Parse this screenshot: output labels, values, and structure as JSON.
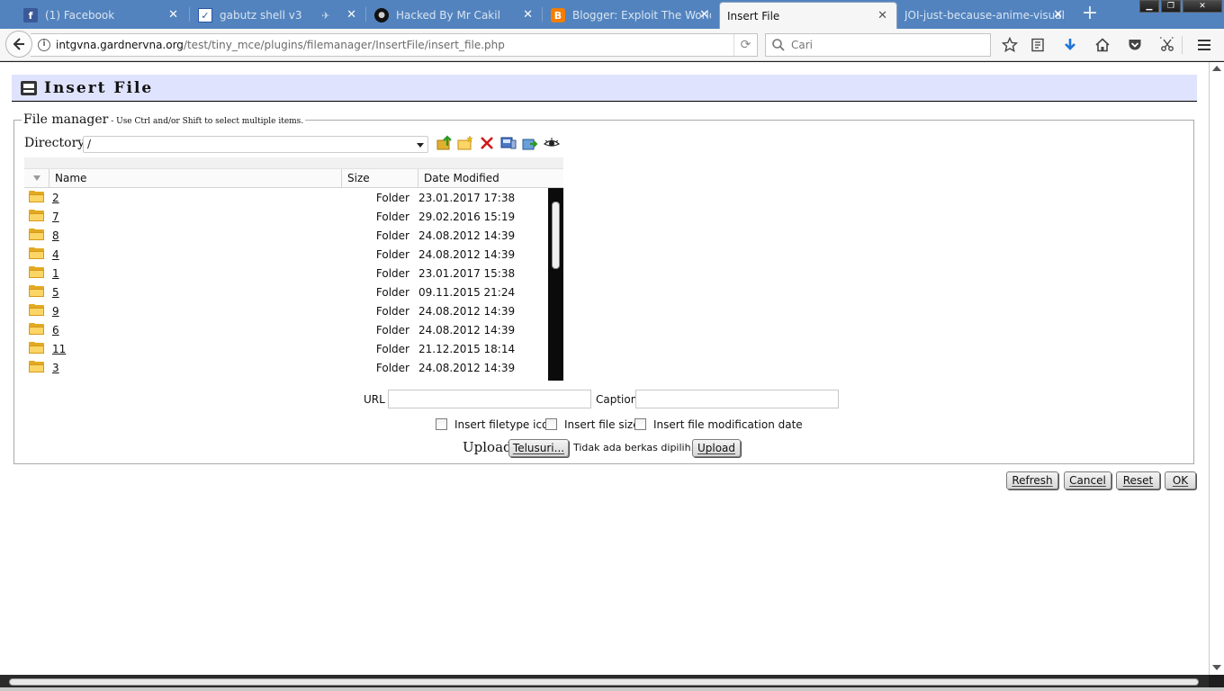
{
  "browser": {
    "tabs": [
      {
        "title": "(1) Facebook",
        "favicon": "facebook-f",
        "color": "#3b5998",
        "active": false
      },
      {
        "title": "gabutz shell v3",
        "favicon": "checkmark",
        "color": "#ffffff",
        "active": false
      },
      {
        "title": "Hacked By Mr Cakil",
        "favicon": "mask",
        "color": "#111111",
        "active": false
      },
      {
        "title": "Blogger: Exploit The World",
        "favicon": "blogger-b",
        "color": "#f57d00",
        "active": false
      },
      {
        "title": "Insert File",
        "favicon": "",
        "color": "",
        "active": true
      },
      {
        "title": "JOI-just-because-anime-visual",
        "favicon": "",
        "color": "",
        "active": false
      }
    ],
    "tab_close_glyph": "✕",
    "new_tab_glyph": "+",
    "address": {
      "domain": "intgvna.gardnervna.org",
      "path": "/test/tiny_mce/plugins/filemanager/InsertFile/insert_file.php"
    },
    "search_placeholder": "Cari"
  },
  "dialog": {
    "title": "Insert File",
    "legend": "File manager",
    "legend_hint": " - Use Ctrl and/or Shift to select multiple items.",
    "directory_label": "Directory",
    "directory_value": "/",
    "toolbar": [
      "go-up-icon",
      "new-folder-icon",
      "delete-icon",
      "edit-icon",
      "move-icon",
      "view-icon"
    ],
    "columns": {
      "name": "Name",
      "size": "Size",
      "date": "Date Modified"
    },
    "files": [
      {
        "name": "2",
        "type": "Folder",
        "date": "23.01.2017 17:38"
      },
      {
        "name": "7",
        "type": "Folder",
        "date": "29.02.2016 15:19"
      },
      {
        "name": "8",
        "type": "Folder",
        "date": "24.08.2012 14:39"
      },
      {
        "name": "4",
        "type": "Folder",
        "date": "24.08.2012 14:39"
      },
      {
        "name": "1",
        "type": "Folder",
        "date": "23.01.2017 15:38"
      },
      {
        "name": "5",
        "type": "Folder",
        "date": "09.11.2015 21:24"
      },
      {
        "name": "9",
        "type": "Folder",
        "date": "24.08.2012 14:39"
      },
      {
        "name": "6",
        "type": "Folder",
        "date": "24.08.2012 14:39"
      },
      {
        "name": "11",
        "type": "Folder",
        "date": "21.12.2015 18:14"
      },
      {
        "name": "3",
        "type": "Folder",
        "date": "24.08.2012 14:39"
      }
    ],
    "url_label": "URL",
    "url_value": "",
    "caption_label": "Caption",
    "caption_value": "",
    "options": {
      "filetype_icon": "Insert filetype icon",
      "file_size": "Insert file size",
      "mod_date": "Insert file modification date"
    },
    "upload": {
      "label": "Upload",
      "browse_button": "Telusuri...",
      "no_file_text": "Tidak ada berkas dipilih.",
      "upload_button": "Upload"
    },
    "buttons": {
      "refresh": "Refresh",
      "cancel": "Cancel",
      "reset": "Reset",
      "ok": "OK"
    },
    "colors": {
      "header_bg": "#dfe3fd",
      "folder": "#fbd565",
      "tabstrip": "#5283be"
    }
  }
}
